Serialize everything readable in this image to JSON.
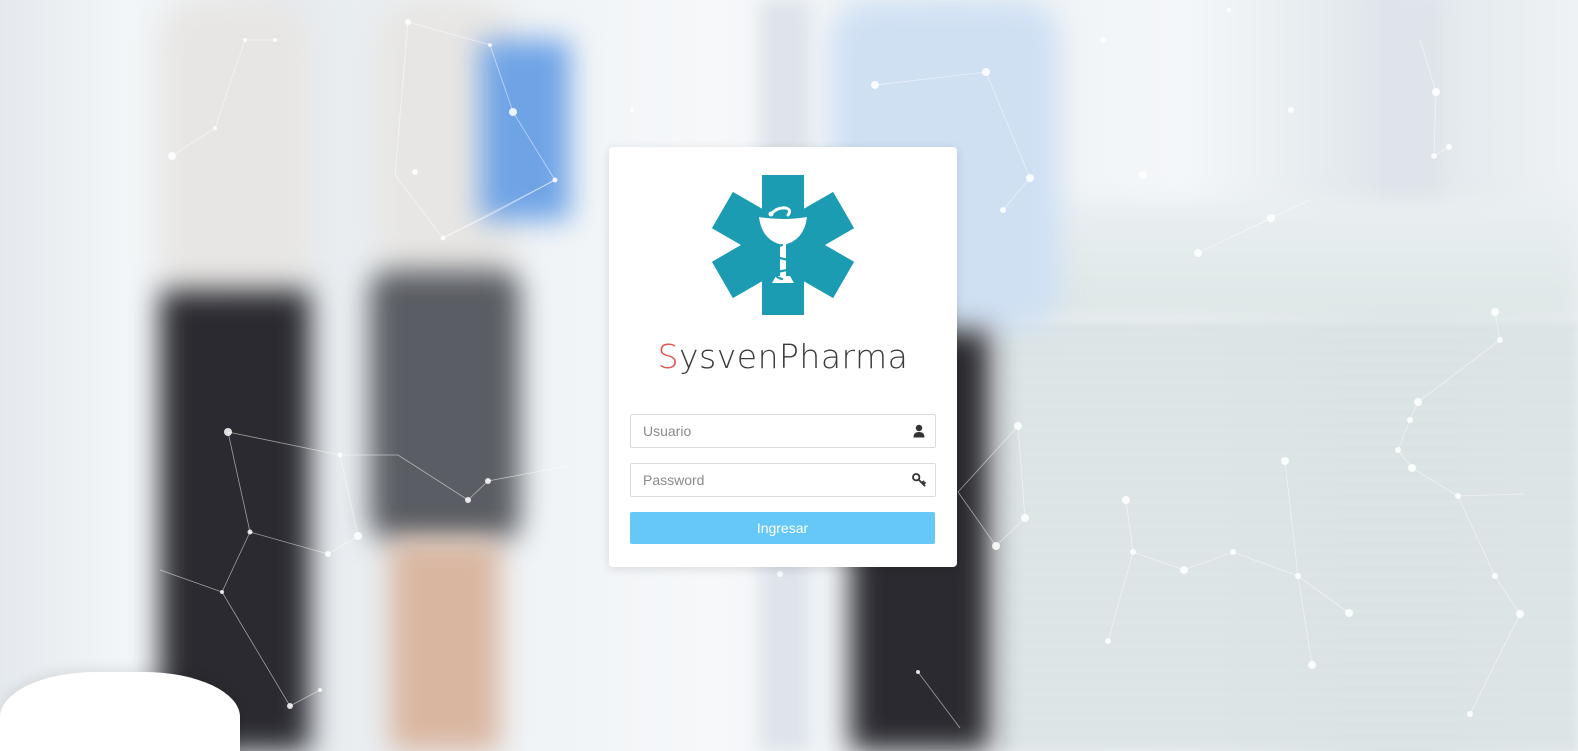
{
  "brand": {
    "first_letter": "S",
    "rest": "ysvenPharma",
    "logo_icon": "star-of-life-caduceus-icon",
    "logo_color": "#1b9cb3",
    "accent_color": "#e2544b"
  },
  "login": {
    "username_placeholder": "Usuario",
    "username_icon": "user-icon",
    "password_placeholder": "Password",
    "password_icon": "key-icon",
    "submit_label": "Ingresar",
    "submit_color": "#66c8f6"
  }
}
